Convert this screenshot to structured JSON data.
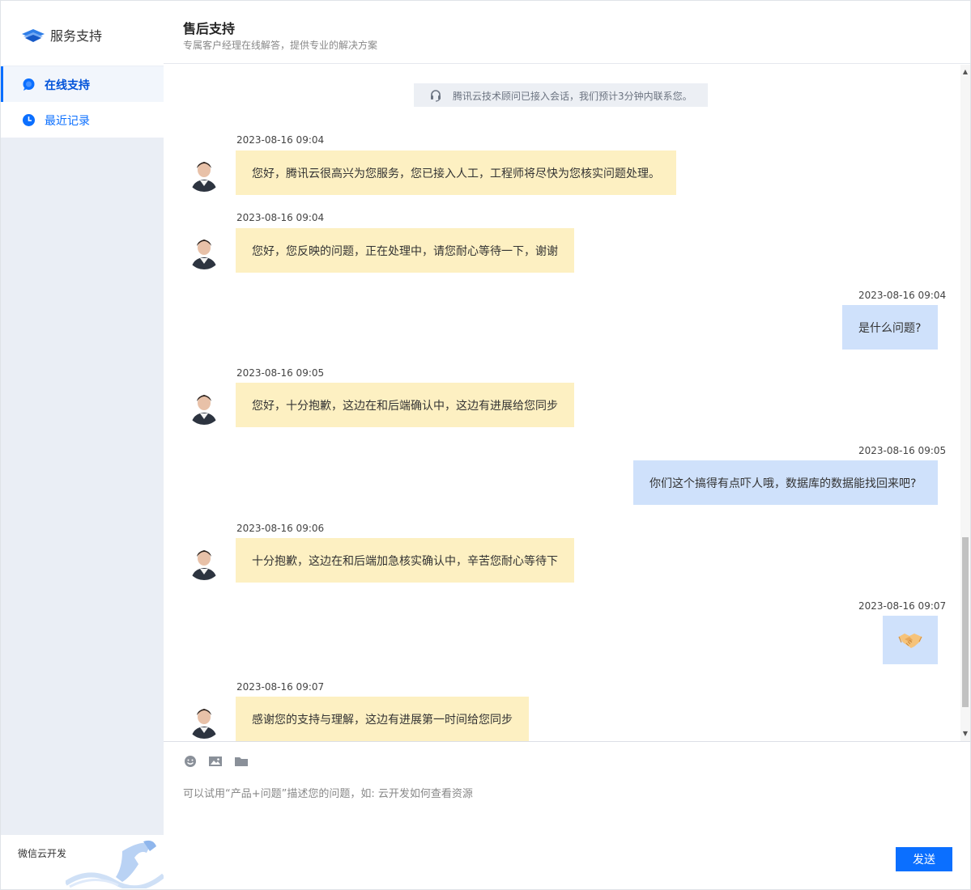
{
  "sidebar": {
    "brand": "服务支持",
    "items": [
      {
        "label": "在线支持",
        "icon": "chat-bubble-icon",
        "active": true
      },
      {
        "label": "最近记录",
        "icon": "clock-icon",
        "active": false
      }
    ],
    "footer": "微信云开发"
  },
  "header": {
    "title": "售后支持",
    "subtitle": "专属客户经理在线解答，提供专业的解决方案"
  },
  "notice": "腾讯云技术顾问已接入会话，我们预计3分钟内联系您。",
  "messages": [
    {
      "sender": "agent",
      "time": "2023-08-16 09:04",
      "text": "您好，腾讯云很高兴为您服务，您已接入人工，工程师将尽快为您核实问题处理。"
    },
    {
      "sender": "agent",
      "time": "2023-08-16 09:04",
      "text": "您好，您反映的问题，正在处理中，请您耐心等待一下，谢谢"
    },
    {
      "sender": "user",
      "time": "2023-08-16 09:04",
      "text": "是什么问题?"
    },
    {
      "sender": "agent",
      "time": "2023-08-16 09:05",
      "text": "您好，十分抱歉，这边在和后端确认中，这边有进展给您同步"
    },
    {
      "sender": "user",
      "time": "2023-08-16 09:05",
      "text": "你们这个搞得有点吓人哦，数据库的数据能找回来吧?"
    },
    {
      "sender": "agent",
      "time": "2023-08-16 09:06",
      "text": "十分抱歉，这边在和后端加急核实确认中，辛苦您耐心等待下"
    },
    {
      "sender": "user",
      "time": "2023-08-16 09:07",
      "text": "",
      "emoji": "handshake-icon"
    },
    {
      "sender": "agent",
      "time": "2023-08-16 09:07",
      "text": "感谢您的支持与理解，这边有进展第一时间给您同步"
    }
  ],
  "composer": {
    "tools": [
      "emoji-icon",
      "image-icon",
      "folder-icon"
    ],
    "placeholder": "可以试用“产品+问题”描述您的问题，如: 云开发如何查看资源",
    "send_label": "发送"
  },
  "colors": {
    "accent": "#0b6fff",
    "agent_bubble": "#fdf0c2",
    "user_bubble": "#cfe1fb",
    "sidebar_bg": "#eaeef5"
  }
}
